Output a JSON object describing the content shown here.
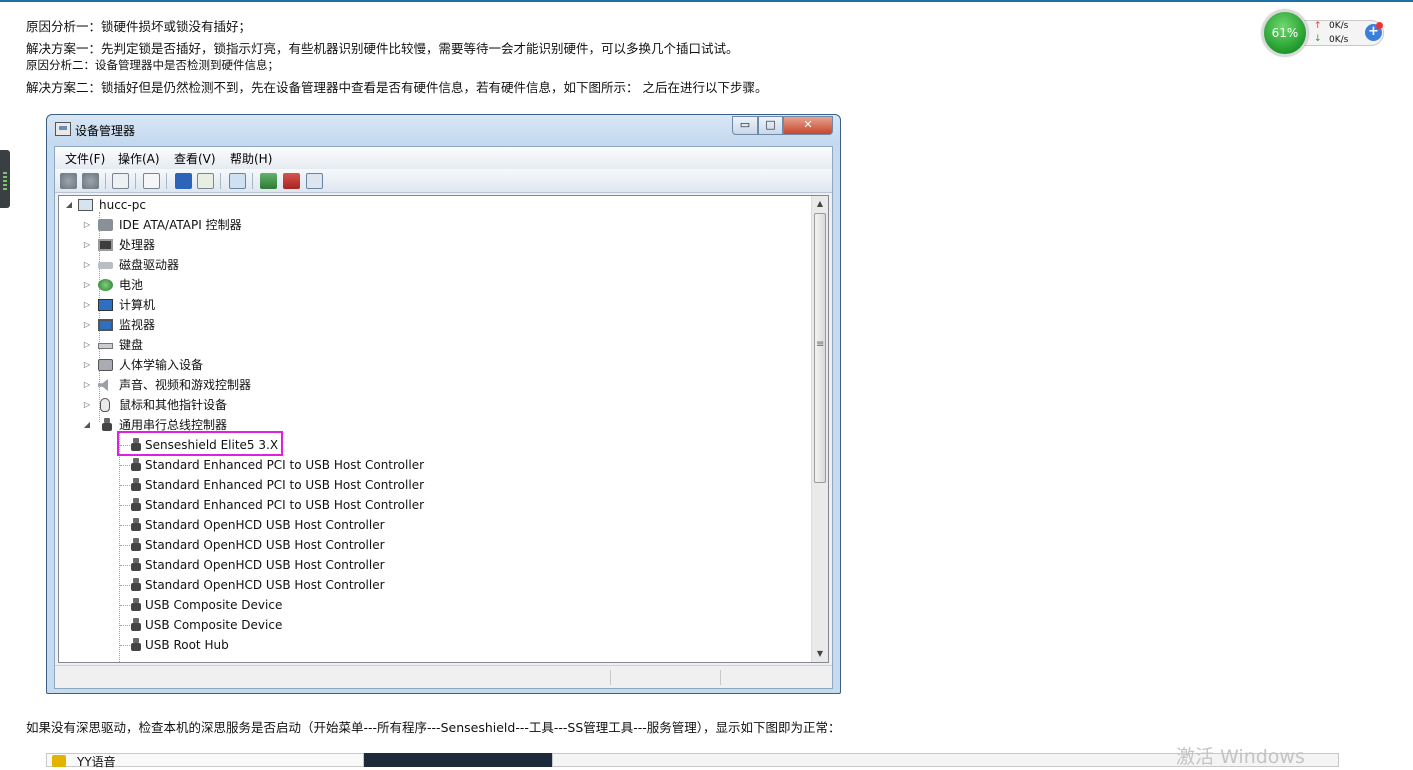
{
  "article": {
    "line1": "原因分析一：锁硬件损坏或锁没有插好；",
    "line2": "解决方案一：先判定锁是否插好，锁指示灯亮，有些机器识别硬件比较慢，需要等待一会才能识别硬件，可以多换几个插口试试。",
    "line3": "原因分析二：设备管理器中是否检测到硬件信息；",
    "line4": "解决方案二：锁插好但是仍然检测不到，先在设备管理器中查看是否有硬件信息，若有硬件信息，如下图所示： 之后在进行以下步骤。",
    "line5": "如果没有深思驱动，检查本机的深思服务是否启动（开始菜单---所有程序---Senseshield---工具---SS管理工具---服务管理），显示如下图即为正常："
  },
  "speed_widget": {
    "percent": "61%",
    "upload": "0K/s",
    "download": "0K/s",
    "plus": "+"
  },
  "window": {
    "title": "设备管理器",
    "minimize": "▭",
    "maximize": "□",
    "close": "✕"
  },
  "menu": [
    "文件(F)",
    "操作(A)",
    "查看(V)",
    "帮助(H)"
  ],
  "tree": {
    "root": "hucc-pc",
    "categories": [
      "IDE ATA/ATAPI 控制器",
      "处理器",
      "磁盘驱动器",
      "电池",
      "计算机",
      "监视器",
      "键盘",
      "人体学输入设备",
      "声音、视频和游戏控制器",
      "鼠标和其他指针设备",
      "通用串行总线控制器"
    ],
    "usb_devices": [
      "Senseshield Elite5 3.X",
      "Standard Enhanced PCI to USB Host Controller",
      "Standard Enhanced PCI to USB Host Controller",
      "Standard Enhanced PCI to USB Host Controller",
      "Standard OpenHCD USB Host Controller",
      "Standard OpenHCD USB Host Controller",
      "Standard OpenHCD USB Host Controller",
      "Standard OpenHCD USB Host Controller",
      "USB Composite Device",
      "USB Composite Device",
      "USB Root Hub"
    ]
  },
  "bottom": {
    "yy_label": "YY语音",
    "watermark": "激活 Windows"
  },
  "colors": {
    "highlight": "#e020e0",
    "title_bar": "#c7dbef",
    "speed_ball": "#1f9a2b"
  }
}
